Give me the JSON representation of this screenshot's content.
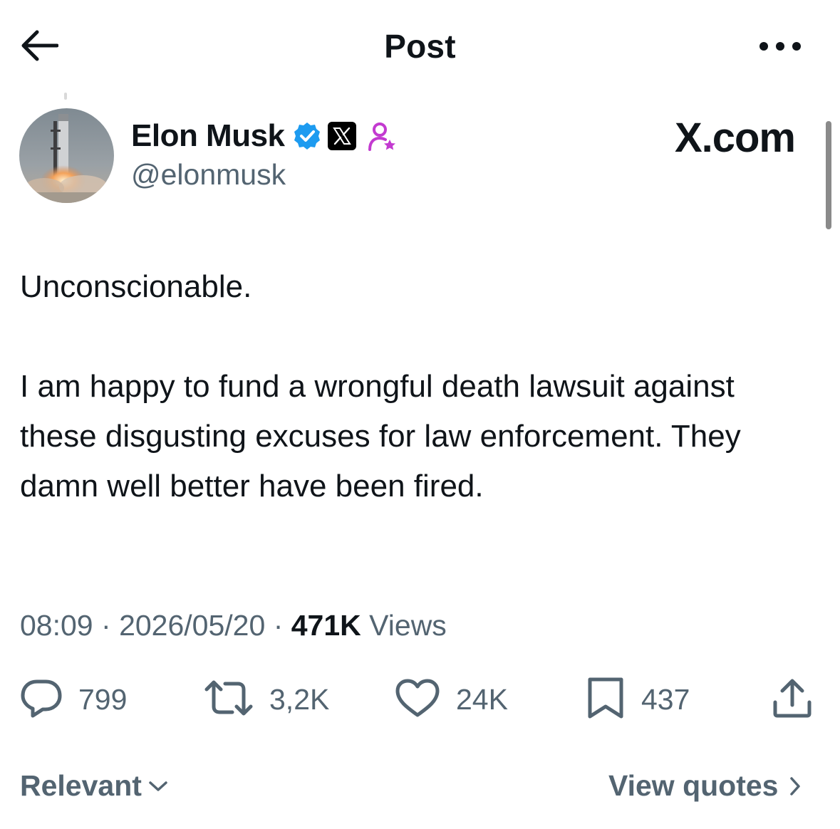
{
  "header": {
    "title": "Post",
    "back_icon": "arrow-left-icon",
    "more_icon": "more-horizontal-icon"
  },
  "author": {
    "name": "Elon Musk",
    "handle": "@elonmusk",
    "verified_icon": "verified-badge-icon",
    "affiliation_icon": "x-logo-icon",
    "subscription_icon": "person-star-icon",
    "avatar": "rocket-launch-avatar"
  },
  "source": "X.com",
  "post": {
    "paragraphs": [
      "Unconscionable.",
      "I am happy to fund a wrongful death lawsuit against these disgusting excuses for law enforcement. They damn well better have been fired."
    ]
  },
  "meta": {
    "time": "08:09",
    "separator": "·",
    "date": "2026/05/20",
    "views_count": "471K",
    "views_label": "Views"
  },
  "actions": {
    "replies": "799",
    "reposts": "3,2K",
    "likes": "24K",
    "bookmarks": "437"
  },
  "footer": {
    "sort_label": "Relevant",
    "quotes_label": "View quotes"
  },
  "colors": {
    "text": "#0f1419",
    "secondary": "#536471",
    "verified": "#1d9bf0",
    "subscription": "#c33ad0"
  }
}
